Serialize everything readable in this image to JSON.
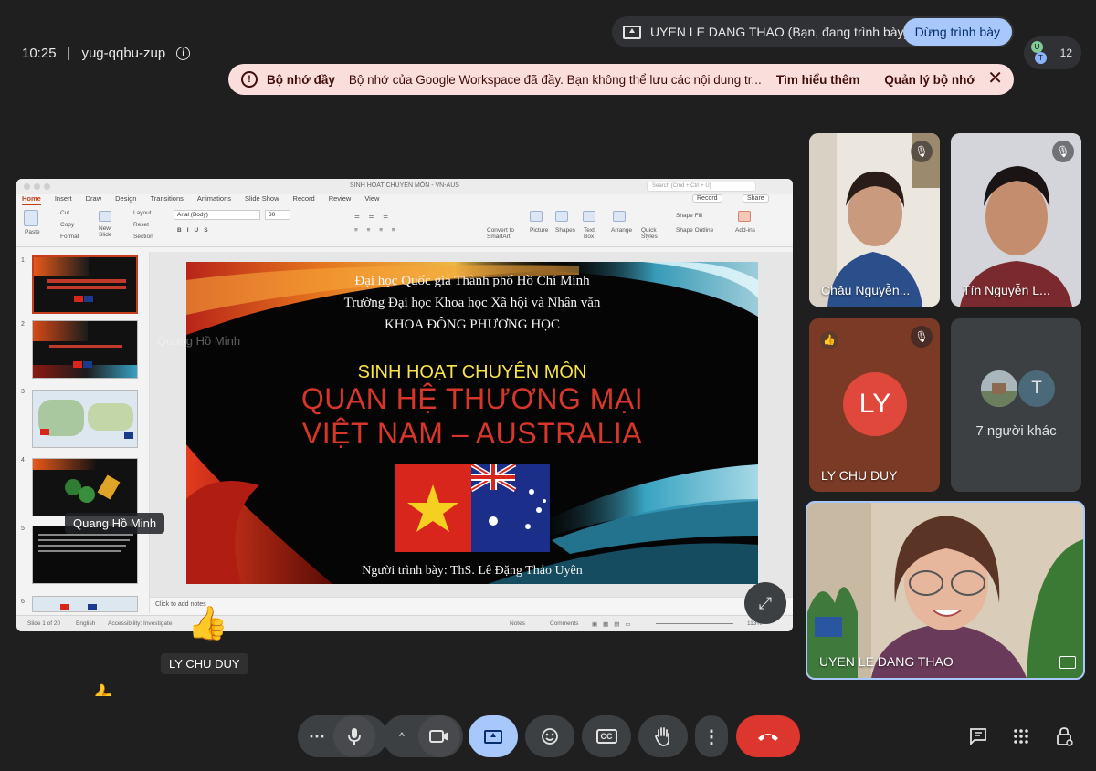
{
  "meeting": {
    "time": "10:25",
    "separator": "|",
    "code": "yug-qqbu-zup",
    "info_icon": "i"
  },
  "presenting": {
    "label": "UYEN LE DANG THAO (Bạn, đang trình bày)",
    "stop_label": "Dừng trình bày"
  },
  "people_count": "12",
  "people_avatars": [
    "U",
    "T"
  ],
  "banner": {
    "title": "Bộ nhớ đầy",
    "message": "Bộ nhớ của Google Workspace đã đầy. Bạn không thể lưu các nội dung tr...",
    "learn_more": "Tìm hiểu thêm",
    "manage": "Quản lý bộ nhớ",
    "close": "✕"
  },
  "ppt": {
    "doc_title": "SINH HOAT CHUYÊN MÔN - VN-AUS",
    "search_placeholder": "Search (Cmd + Ctrl + U)",
    "tabs": [
      "Home",
      "Insert",
      "Draw",
      "Design",
      "Transitions",
      "Animations",
      "Slide Show",
      "Record",
      "Review",
      "View"
    ],
    "record_label": "Record",
    "share_label": "Share",
    "ribbon": {
      "paste": "Paste",
      "cut": "Cut",
      "copy": "Copy",
      "format": "Format",
      "new_slide": "New Slide",
      "layout": "Layout",
      "reset": "Reset",
      "section": "Section",
      "font": "Arial (Body)",
      "size": "30",
      "convert": "Convert to SmartArt",
      "picture": "Picture",
      "shapes": "Shapes",
      "text_box": "Text Box",
      "arrange": "Arrange",
      "quick_styles": "Quick Styles",
      "shape_fill": "Shape Fill",
      "shape_outline": "Shape Outline",
      "add_ins": "Add-ins"
    },
    "thumb_numbers": [
      "1",
      "2",
      "3",
      "4",
      "5",
      "6"
    ],
    "slide": {
      "line1": "Đại học Quốc gia Thành phố Hồ Chí Minh",
      "line2": "Trường Đại học Khoa học Xã hội và Nhân văn",
      "line3": "KHOA ĐÔNG PHƯƠNG HỌC",
      "title0": "SINH HOẠT CHUYÊN MÔN",
      "title1": "QUAN HỆ THƯƠNG MẠI",
      "title2": "VIỆT NAM – AUSTRALIA",
      "presenter": "Người trình bày: ThS. Lê Đặng Thảo Uyên"
    },
    "notes_placeholder": "Click to add notes",
    "status": {
      "slide": "Slide 1 of 20",
      "lang": "English",
      "accessibility": "Accessibility: Investigate",
      "notes": "Notes",
      "comments": "Comments",
      "zoom": "113%"
    }
  },
  "floating": {
    "ghost_name": "Quang Hồ Minh",
    "name1": "Quang Hồ Minh",
    "reaction_name": "LY CHU DUY"
  },
  "tiles": {
    "chau": {
      "name": "Châu Nguyễn..."
    },
    "tin": {
      "name": "Tín Nguyễn L..."
    },
    "ly": {
      "initials": "LY",
      "name": "LY CHU DUY"
    },
    "others": {
      "initial": "T",
      "label": "7 người khác"
    },
    "self": {
      "name": "UYEN LE DANG THAO"
    }
  },
  "controls": {
    "more": "⋯",
    "chevron": "^",
    "cc": "CC",
    "options": "⋮"
  },
  "colors": {
    "bg": "#1f1f1f",
    "accent": "#a8c7fa",
    "end_call": "#dc362e",
    "banner": "#f9dedc",
    "slide_title": "#d8362a",
    "avatar_ly": "#e0483c"
  }
}
